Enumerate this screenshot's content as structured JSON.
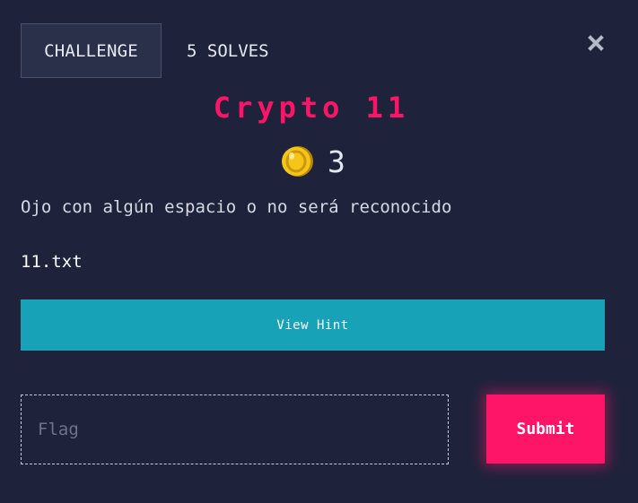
{
  "tabs": {
    "challenge_label": "CHALLENGE",
    "solves_label": "5 SOLVES"
  },
  "challenge": {
    "name": "Crypto 11",
    "points": "3",
    "description": "Ojo con algún espacio o no será reconocido",
    "file_name": "11.txt"
  },
  "actions": {
    "hint_label": "View Hint",
    "flag_placeholder": "Flag",
    "submit_label": "Submit"
  },
  "icons": {
    "close": "close-icon",
    "coin": "coin-icon"
  },
  "colors": {
    "background": "#1e233b",
    "accent": "#ff1567",
    "hint": "#17a2b8",
    "coin": "#f5c518"
  }
}
